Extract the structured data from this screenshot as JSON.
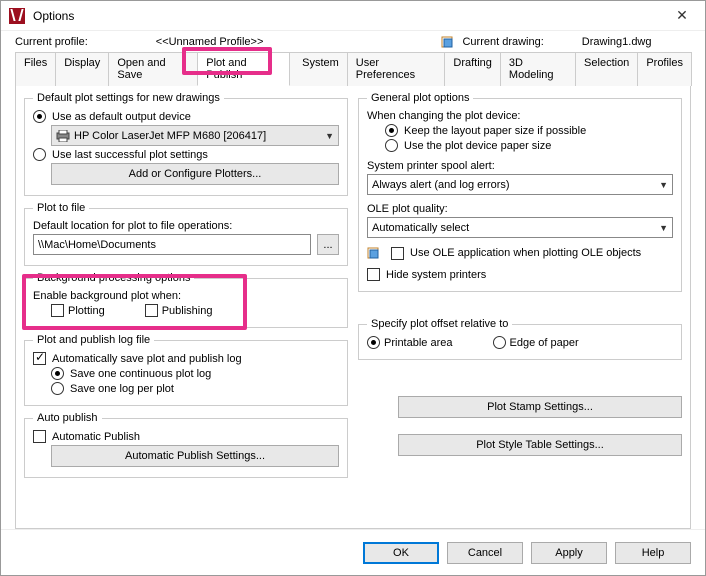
{
  "window": {
    "title": "Options"
  },
  "header": {
    "profile_label": "Current profile:",
    "profile_value": "<<Unnamed Profile>>",
    "drawing_label": "Current drawing:",
    "drawing_value": "Drawing1.dwg"
  },
  "tabs": [
    "Files",
    "Display",
    "Open and Save",
    "Plot and Publish",
    "System",
    "User Preferences",
    "Drafting",
    "3D Modeling",
    "Selection",
    "Profiles"
  ],
  "active_tab": "Plot and Publish",
  "left": {
    "default_plot": {
      "legend": "Default plot settings for new drawings",
      "opt1": "Use as default output device",
      "device": "HP Color LaserJet MFP M680 [206417]",
      "opt2": "Use last successful plot settings",
      "btn": "Add or Configure Plotters..."
    },
    "plot_to_file": {
      "legend": "Plot to file",
      "label": "Default location for plot to file operations:",
      "path": "\\\\Mac\\Home\\Documents",
      "browse": "..."
    },
    "bg": {
      "legend": "Background processing options",
      "label": "Enable background plot when:",
      "plotting": "Plotting",
      "publishing": "Publishing"
    },
    "log": {
      "legend": "Plot and publish log file",
      "auto_save": "Automatically save plot and publish log",
      "one_log": "Save one continuous plot log",
      "per_plot": "Save one log per plot"
    },
    "auto_pub": {
      "legend": "Auto publish",
      "check": "Automatic Publish",
      "btn": "Automatic Publish Settings..."
    }
  },
  "right": {
    "general": {
      "legend": "General plot options",
      "change_label": "When changing the plot device:",
      "keep_layout": "Keep the layout paper size if possible",
      "use_device": "Use the plot device paper size",
      "spool_label": "System printer spool alert:",
      "spool_val": "Always alert (and log errors)",
      "ole_label": "OLE plot quality:",
      "ole_val": "Automatically select",
      "ole_app": "Use OLE application when plotting OLE objects",
      "hide_printers": "Hide system printers"
    },
    "offset": {
      "legend": "Specify plot offset relative to",
      "printable": "Printable area",
      "edge": "Edge of paper"
    },
    "stamp_btn": "Plot Stamp Settings...",
    "style_btn": "Plot Style Table Settings..."
  },
  "buttons": {
    "ok": "OK",
    "cancel": "Cancel",
    "apply": "Apply",
    "help": "Help"
  }
}
